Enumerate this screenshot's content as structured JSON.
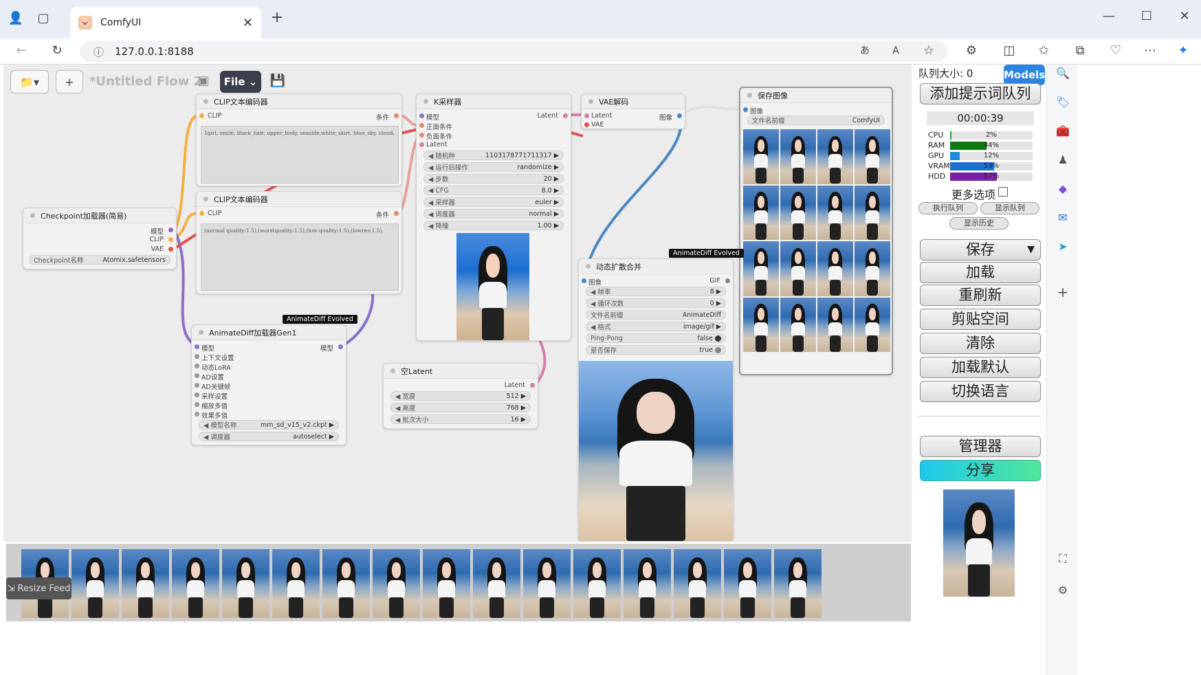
{
  "browser": {
    "tab_title": "ComfyUI",
    "url": "127.0.0.1:8188",
    "new_tab": "+",
    "close": "✕"
  },
  "graph_toolbar": {
    "flow_name": "*Untitled Flow 2",
    "file_label": "File",
    "add_icon": "+"
  },
  "nodes": {
    "checkpoint": {
      "title": "Checkpoint加载器(简易)",
      "out_model": "模型",
      "out_clip": "CLIP",
      "out_vae": "VAE",
      "ckpt_label": "Checkpoint名称",
      "ckpt_value": "Atomix.safetensors"
    },
    "clip_pos": {
      "title": "CLIP文本编码器",
      "in_clip": "CLIP",
      "out": "条件",
      "text": "1girl, smile, black_hair, upper_body, seaside,white_skirt, blue_sky, cloud,"
    },
    "clip_neg": {
      "title": "CLIP文本编码器",
      "in_clip": "CLIP",
      "out": "条件",
      "text": "(normal quality:1.5),(worstquality:1.5),(low quality:1.5),(lowres:1.5),"
    },
    "ksampler": {
      "title": "K采样器",
      "inputs": [
        "模型",
        "正面条件",
        "负面条件",
        "Latent"
      ],
      "out": "Latent",
      "widgets": [
        {
          "k": "随机种",
          "v": "1103178771711317"
        },
        {
          "k": "运行后操作",
          "v": "randomize"
        },
        {
          "k": "步数",
          "v": "20"
        },
        {
          "k": "CFG",
          "v": "8.0"
        },
        {
          "k": "采样器",
          "v": "euler"
        },
        {
          "k": "调度器",
          "v": "normal"
        },
        {
          "k": "降噪",
          "v": "1.00"
        }
      ]
    },
    "vae": {
      "title": "VAE解码",
      "in1": "Latent",
      "in2": "VAE",
      "out": "图像"
    },
    "save": {
      "title": "保存图像",
      "in": "图像",
      "prefix_label": "文件名前缀",
      "prefix_value": "ComfyUI"
    },
    "animatediff": {
      "badge": "AnimateDiff Evolved",
      "title": "AnimateDiff加载器Gen1",
      "inputs": [
        "模型",
        "上下文设置",
        "动态LoRA",
        "AD设置",
        "AD关键帧",
        "采样设置",
        "缩放多值",
        "效果多值"
      ],
      "out": "模型",
      "widgets": [
        {
          "k": "模型名称",
          "v": "mm_sd_v15_v2.ckpt"
        },
        {
          "k": "调度器",
          "v": "autoselect"
        }
      ]
    },
    "latent": {
      "title": "空Latent",
      "out": "Latent",
      "widgets": [
        {
          "k": "宽度",
          "v": "512"
        },
        {
          "k": "高度",
          "v": "768"
        },
        {
          "k": "批次大小",
          "v": "16"
        }
      ]
    },
    "combine": {
      "badge": "AnimateDiff Evolved",
      "title": "动态扩散合并",
      "in": "图像",
      "out": "GIF",
      "widgets": [
        {
          "k": "帧率",
          "v": "8"
        },
        {
          "k": "循环次数",
          "v": "0"
        },
        {
          "k": "文件名前缀",
          "v": "AnimateDiff"
        },
        {
          "k": "格式",
          "v": "image/gif"
        },
        {
          "k": "Ping-Pong",
          "v": "false"
        },
        {
          "k": "是否保存",
          "v": "true"
        }
      ]
    }
  },
  "feed": {
    "resize_label": "Resize Feed",
    "thumbnail_count": 16
  },
  "panel": {
    "queue_size": "队列大小: 0",
    "models_label": "Models",
    "queue_prompt": "添加提示词队列",
    "timer": "00:00:39",
    "monitors": [
      {
        "k": "CPU",
        "v": "2%",
        "pct": 2,
        "color": "#1aa31a"
      },
      {
        "k": "RAM",
        "v": "44%",
        "pct": 44,
        "color": "#0c7a0c"
      },
      {
        "k": "GPU",
        "v": "12%",
        "pct": 12,
        "color": "#1f8be0"
      },
      {
        "k": "VRAM",
        "v": "53%",
        "pct": 53,
        "color": "#1c6fd0"
      },
      {
        "k": "HDD",
        "v": "57%",
        "pct": 57,
        "color": "#7a1fa8"
      }
    ],
    "more_options": "更多选项",
    "view_queue": "执行队列",
    "show_queue": "显示队列",
    "view_history": "显示历史",
    "save": "保存",
    "load": "加载",
    "refresh": "重刷新",
    "clipspace": "剪贴空间",
    "clear": "清除",
    "load_default": "加载默认",
    "switch_lang": "切换语言",
    "manager": "管理器",
    "share": "分享"
  }
}
